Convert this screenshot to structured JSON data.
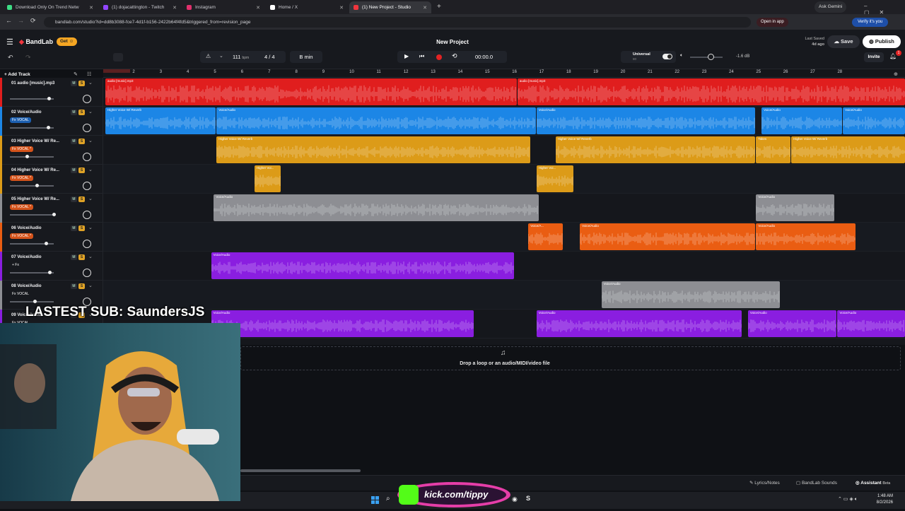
{
  "browser": {
    "tabs": [
      {
        "label": "Download Only On Trend Netw",
        "color": "#3ddc84"
      },
      {
        "label": "(1) dojacattington - Twitch",
        "color": "#9146ff"
      },
      {
        "label": "Instagram",
        "color": "#e1306c"
      },
      {
        "label": "Home / X",
        "color": "#ffffff"
      },
      {
        "label": "(1) New Project - Studio",
        "color": "#f0353d"
      }
    ],
    "url": "bandlab.com/studio?id=dd8b3088-fce7-4d1f-b156-2422b64f4fd5&triggered_from=revision_page",
    "ask_gemini": "Ask Gemini",
    "open_in_app": "Open in app",
    "verify": "Verify it's you"
  },
  "app": {
    "logo": "BandLab",
    "get_label": "Get",
    "project_title": "New Project",
    "last_saved_label": "Last Saved",
    "last_saved_time": "4d ago",
    "save_label": "Save",
    "publish_label": "Publish",
    "invite_label": "Invite",
    "notification_count": "1",
    "tempo": "111",
    "tempo_unit": "bpm",
    "time_sig": "4 / 4",
    "key": "B min",
    "time_display": "00:00.0",
    "preset_name": "Universal",
    "preset_sub": "80",
    "volume_db": "-1.6 dB",
    "add_track": "Add Track"
  },
  "ruler": [
    "1",
    "2",
    "3",
    "4",
    "5",
    "6",
    "7",
    "8",
    "9",
    "10",
    "11",
    "12",
    "13",
    "14",
    "15",
    "16",
    "17",
    "18",
    "19",
    "20",
    "21",
    "22",
    "23",
    "24",
    "25",
    "26",
    "27",
    "28"
  ],
  "tracks": [
    {
      "name": "01 audio [music].mp3",
      "fx": "",
      "color": "#e01e1e",
      "vol": 0.88,
      "clips": [
        {
          "label": "audio [music].mp3",
          "start": 1,
          "end": 16.2
        },
        {
          "label": "audio [music].mp3",
          "start": 16.2,
          "end": 31
        }
      ]
    },
    {
      "name": "02 Voice/Audio",
      "fx": "Fx VOCAL",
      "color": "#1c86e6",
      "vol": 0.86,
      "clips": [
        {
          "label": "Higher Voice W/ Reverb",
          "start": 1,
          "end": 5.1
        },
        {
          "label": "Voice/Audio",
          "start": 5.1,
          "end": 16.9
        },
        {
          "label": "Voice/Audio",
          "start": 16.9,
          "end": 25
        },
        {
          "label": "Voice/Audio",
          "start": 25.2,
          "end": 28.2
        },
        {
          "label": "Voice/Audio",
          "start": 28.2,
          "end": 31
        }
      ]
    },
    {
      "name": "03 Higher Voice W/ Re...",
      "fx": "Fx VOCAL *",
      "color": "#dc9b18",
      "vol": 0.37,
      "clips": [
        {
          "label": "Higher Voice W/ Reverb",
          "start": 5.1,
          "end": 16.7
        },
        {
          "label": "Higher Voice W/ Reverb",
          "start": 17.6,
          "end": 25
        },
        {
          "label": "Takes",
          "start": 25,
          "end": 26.3
        },
        {
          "label": "Higher Voice W/ Reverb",
          "start": 26.3,
          "end": 31
        }
      ]
    },
    {
      "name": "04 Higher Voice W/ Re...",
      "fx": "Fx VOCAL *",
      "color": "#dc9b18",
      "vol": 0.6,
      "clips": [
        {
          "label": "Higher Voi...",
          "start": 6.5,
          "end": 7.5
        },
        {
          "label": "Higher Voi...",
          "start": 16.9,
          "end": 18.3
        }
      ]
    },
    {
      "name": "05 Higher Voice W/ Re...",
      "fx": "Fx VOCAL *",
      "color": "#8d8e93",
      "vol": 1.0,
      "clips": [
        {
          "label": "Voice/Audio",
          "start": 5,
          "end": 17
        },
        {
          "label": "Voice/Audio",
          "start": 25,
          "end": 27.9
        }
      ]
    },
    {
      "name": "06 Voice/Audio",
      "fx": "Fx VOCAL *",
      "color": "#ea5d12",
      "vol": 0.82,
      "clips": [
        {
          "label": "Voice/A...",
          "start": 16.6,
          "end": 17.9
        },
        {
          "label": "Voice/Audio",
          "start": 18.5,
          "end": 25
        },
        {
          "label": "Voice/Audio",
          "start": 25,
          "end": 28.7
        }
      ]
    },
    {
      "name": "07 Voice/Audio",
      "fx": "+ Fx",
      "color": "#8a1ee0",
      "vol": 0.9,
      "clips": [
        {
          "label": "Voice/Audio",
          "start": 4.9,
          "end": 16.1
        }
      ]
    },
    {
      "name": "08 Voice/Audio",
      "fx": "Fx VOCAL",
      "color": "#8d8e93",
      "vol": 0.55,
      "clips": [
        {
          "label": "Voice/Audio",
          "start": 19.3,
          "end": 25.9
        }
      ]
    },
    {
      "name": "09 Voice/Audio",
      "fx": "Fx VOCAL",
      "color": "#8a1ee0",
      "vol": 0.7,
      "clips": [
        {
          "label": "Voice/Audio",
          "start": 4.9,
          "end": 14.6
        },
        {
          "label": "Voice/Audio",
          "start": 16.9,
          "end": 24.5
        },
        {
          "label": "Voice/Audio",
          "start": 24.7,
          "end": 28
        },
        {
          "label": "Voice/Audio",
          "start": 28,
          "end": 31
        }
      ]
    }
  ],
  "drop_text": "Drop a loop or an audio/MIDI/video file",
  "bottom": {
    "lyrics": "Lyrics/Notes",
    "sounds": "BandLab Sounds",
    "assistant": "Assistant",
    "beta": "Beta"
  },
  "taskbar": {
    "time": "1:48 AM",
    "date": "8/2/2026"
  },
  "overlay": {
    "sub_text": "LASTEST SUB: SaundersJS",
    "kick_text": "kick.com/tippy"
  }
}
